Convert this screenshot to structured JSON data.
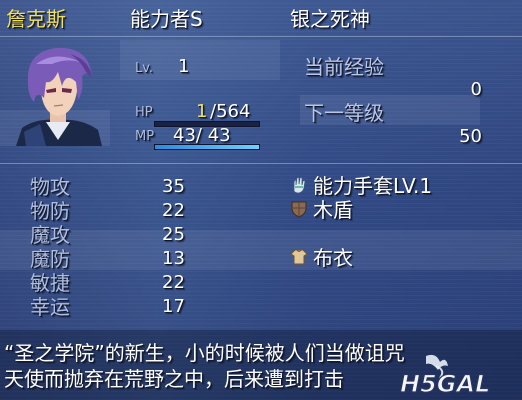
{
  "header": {
    "character_name": "詹克斯",
    "class_title": "能力者S",
    "epithet": "银之死神"
  },
  "stats_top": {
    "level_label": "Lv.",
    "level_value": "1",
    "hp_label": "HP",
    "hp_current": "1",
    "hp_sep_max": "/564",
    "hp_fraction": 0.0018,
    "mp_label": "MP",
    "mp_value_text": "43/ 43",
    "mp_fraction": 1.0
  },
  "experience": {
    "current_label": "当前经验",
    "current_value": "0",
    "next_label": "下一等级",
    "next_value": "50"
  },
  "attributes": [
    {
      "label": "物攻",
      "value": "35"
    },
    {
      "label": "物防",
      "value": "22"
    },
    {
      "label": "魔攻",
      "value": "25"
    },
    {
      "label": "魔防",
      "value": "13"
    },
    {
      "label": "敏捷",
      "value": "22"
    },
    {
      "label": "幸运",
      "value": "17"
    }
  ],
  "equipment": [
    {
      "name": "能力手套LV.1",
      "icon": "glove-icon"
    },
    {
      "name": "木盾",
      "icon": "shield-icon"
    },
    {
      "name": "",
      "icon": ""
    },
    {
      "name": "布衣",
      "icon": "cloth-armor-icon"
    }
  ],
  "description": {
    "line1": "“圣之学院”的新生，小的时候被人们当做诅咒",
    "line2": "天使而抛弃在荒野之中，后来遭到打击"
  },
  "watermark": {
    "text": "H5GAL"
  },
  "colors": {
    "name": "#f0e060",
    "hp_current": "#f0e060",
    "hp_bar": "#f08030",
    "mp_bar": "#4ab0f0",
    "window": "#2b3f78"
  }
}
